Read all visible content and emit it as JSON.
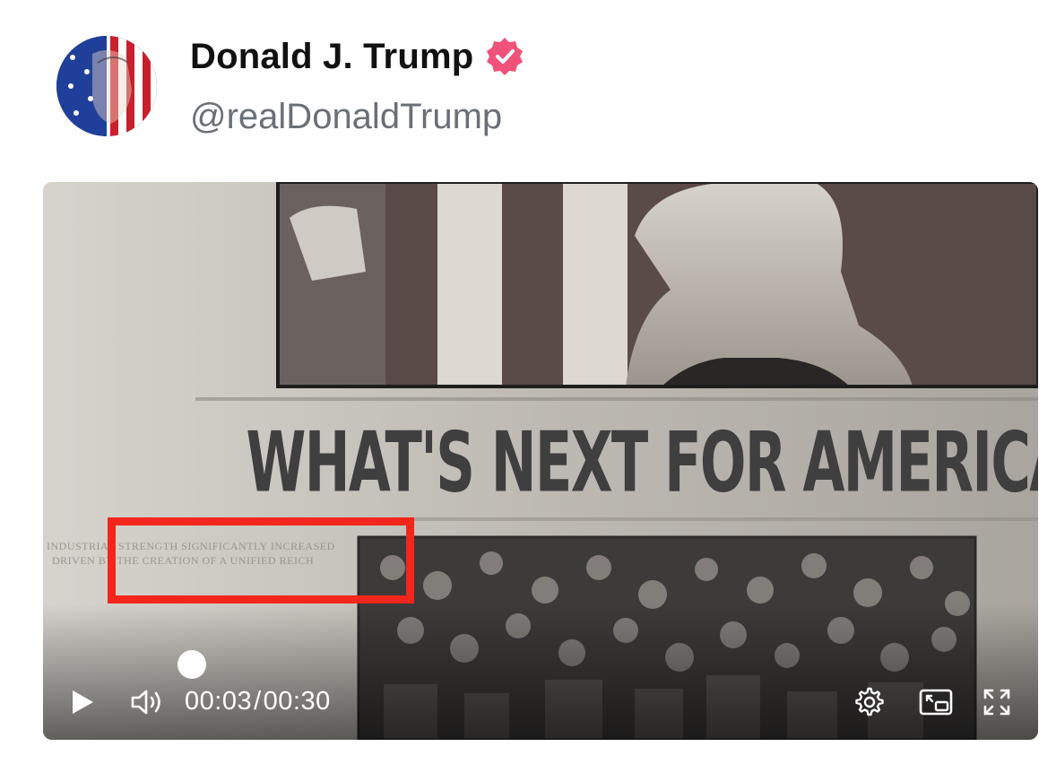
{
  "post": {
    "author_name": "Donald J. Trump",
    "handle": "@realDonaldTrump",
    "verified_icon": "verified-badge-icon",
    "verified_color": "#f0527a"
  },
  "video": {
    "headline": "WHAT'S NEXT FOR AMERICA?",
    "caption_line_1": "INDUSTRIAL STRENGTH SIGNIFICANTLY INCREASED",
    "caption_line_2": "DRIVEN BY THE CREATION OF A UNIFIED REICH",
    "highlight_color": "#f2261a",
    "current_time": "00:03",
    "duration": "00:30",
    "time_separator": "/",
    "progress_fraction": 0.1,
    "controls": {
      "play_icon": "play-icon",
      "volume_icon": "volume-icon",
      "settings_icon": "gear-icon",
      "pip_icon": "picture-in-picture-icon",
      "fullscreen_icon": "fullscreen-icon"
    }
  }
}
